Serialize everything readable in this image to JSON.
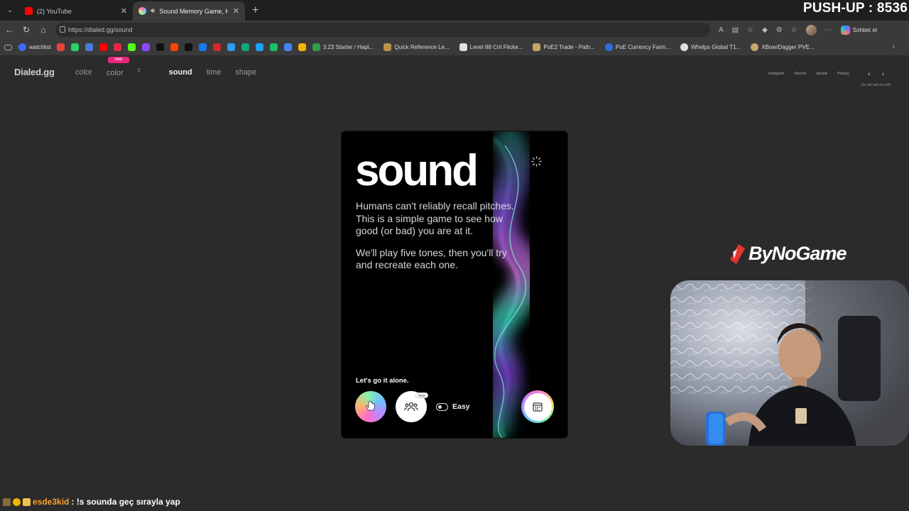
{
  "browser": {
    "tabs": [
      {
        "label": "(2) YouTube",
        "favicon_color": "#ff0000"
      },
      {
        "label": "Sound Memory Game, How G",
        "favicon_color": "#7a8cff"
      }
    ],
    "url": "https://dialed.gg/sound",
    "copilot_label": "Sohbet et",
    "bookmarks": [
      {
        "label": "watchlist",
        "color": "#3b6bff"
      },
      {
        "label": "3.23 Starter / Hapl...",
        "color": "#2e9e4a"
      },
      {
        "label": "Quick Reference Le...",
        "color": "#b9934b"
      },
      {
        "label": "Level 88 Crit Flicke...",
        "color": "#e0e0e0"
      },
      {
        "label": "PoE2 Trade - Path...",
        "color": "#c7a46a"
      },
      {
        "label": "PoE Currency Farm...",
        "color": "#2f6ce0"
      },
      {
        "label": "Whelps Global T1...",
        "color": "#e0e0e0"
      },
      {
        "label": "XBow/Dagger PVE...",
        "color": "#c9a46a"
      }
    ],
    "bookmark_icon_colors": [
      "#ea4335",
      "#25d366",
      "#4a7bd8",
      "#ff0000",
      "#e8264b",
      "#53fc18",
      "#9146ff",
      "#111111",
      "#ff4500",
      "#111111",
      "#1877f2",
      "#d62828",
      "#2f9bf0",
      "#10a37f",
      "#1da1f2",
      "#1bbf6b",
      "#4285f4",
      "#f4b400"
    ]
  },
  "overlay": {
    "pushup": "PUSH-UP : 8536",
    "sponsor": "ByNoGame",
    "chat": {
      "user": "esde3kid",
      "message": ": !s sounda geç sırayla yap"
    }
  },
  "site": {
    "logo": "Dialed.gg",
    "nav": [
      {
        "label": "color"
      },
      {
        "label": "color",
        "sup": "2",
        "badge": "new"
      },
      {
        "label": "sound",
        "current": true
      },
      {
        "label": "time"
      },
      {
        "label": "shape"
      }
    ],
    "links": [
      "Instagram",
      "Discord",
      "Socials",
      "Privacy"
    ],
    "do_not_sell": "Do not sell my info"
  },
  "card": {
    "title": "sound",
    "paragraph1": "Humans can't reliably recall pitches. This is a simple game to see how good (or bad) you are at it.",
    "paragraph2": "We'll play five tones, then you'll try and recreate each one.",
    "alone_label": "Let's go it alone.",
    "beta_label": "beta",
    "difficulty_label": "Easy"
  }
}
